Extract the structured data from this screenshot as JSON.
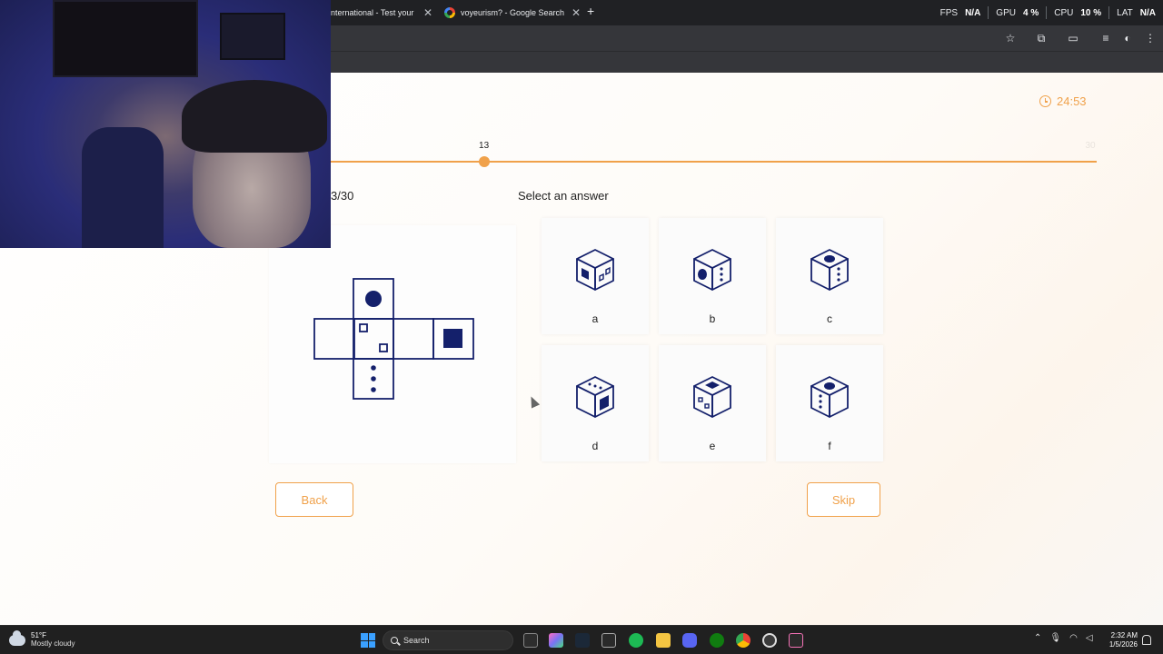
{
  "browser": {
    "tabs": [
      {
        "label": "nternational - Test your Inte",
        "active": true
      },
      {
        "label": "voyeurism? - Google Search",
        "active": false
      }
    ],
    "stats": {
      "fps_label": "FPS",
      "fps_value": "N/A",
      "gpu_label": "GPU",
      "gpu_value": "4",
      "cpu_label": "CPU",
      "cpu_value": "10",
      "lat_label": "LAT",
      "lat_value": "N/A",
      "percent_sign": "%"
    }
  },
  "quiz": {
    "timer": "24:53",
    "progress": {
      "current": "13",
      "max": "30",
      "fraction": 0.2
    },
    "question_counter": "3/30",
    "select_title": "Select an answer",
    "options": [
      {
        "label": "a"
      },
      {
        "label": "b"
      },
      {
        "label": "c"
      },
      {
        "label": "d"
      },
      {
        "label": "e"
      },
      {
        "label": "f"
      }
    ],
    "back_label": "Back",
    "skip_label": "Skip",
    "accent_color": "#f0a14a",
    "figure_color": "#14206b"
  },
  "taskbar": {
    "weather_temp": "51°F",
    "weather_desc": "Mostly cloudy",
    "search_label": "Search",
    "time": "2:32 AM",
    "date": "1/5/2026"
  }
}
